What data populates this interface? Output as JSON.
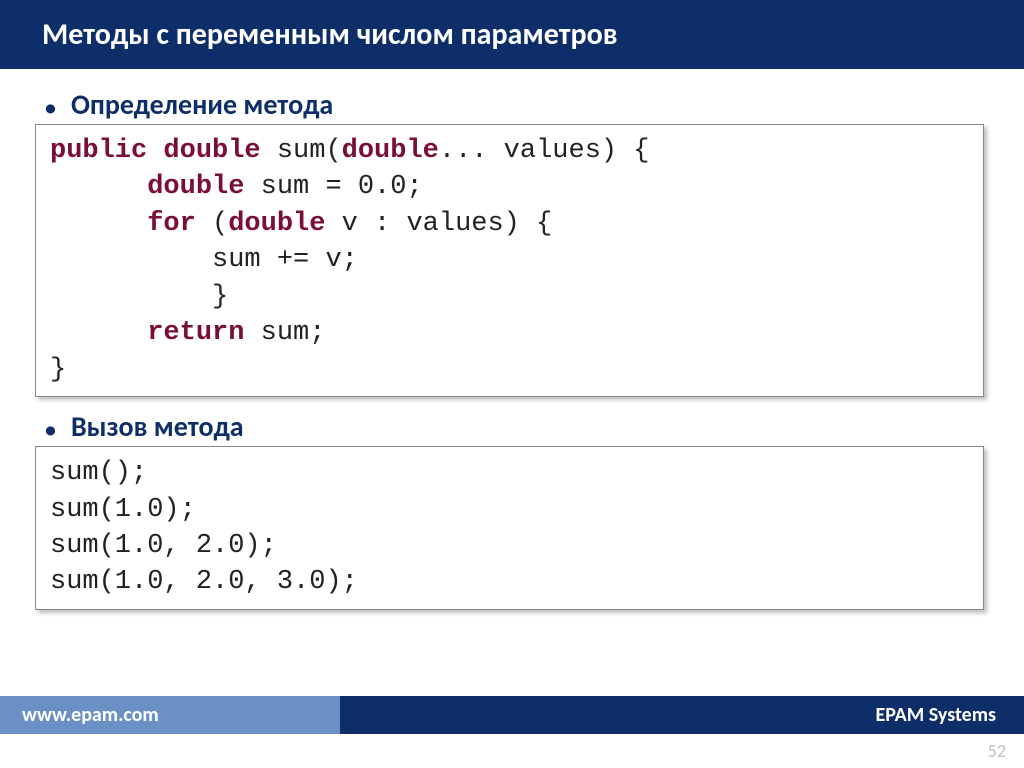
{
  "title": "Методы с переменным числом параметров",
  "bullets": {
    "definition": "Определение метода",
    "call": "Вызов метода"
  },
  "code1": {
    "tokens": [
      {
        "t": "public",
        "c": "kw"
      },
      {
        "t": " "
      },
      {
        "t": "double",
        "c": "kw"
      },
      {
        "t": " sum("
      },
      {
        "t": "double",
        "c": "kw"
      },
      {
        "t": "... values) {\n"
      },
      {
        "t": "      "
      },
      {
        "t": "double",
        "c": "kw"
      },
      {
        "t": " sum = 0.0;\n"
      },
      {
        "t": "      "
      },
      {
        "t": "for",
        "c": "kw"
      },
      {
        "t": " ("
      },
      {
        "t": "double",
        "c": "kw"
      },
      {
        "t": " v : values) {\n"
      },
      {
        "t": "          sum += v;\n"
      },
      {
        "t": "          }\n"
      },
      {
        "t": "      "
      },
      {
        "t": "return",
        "c": "kw"
      },
      {
        "t": " sum;\n"
      },
      {
        "t": "}"
      }
    ]
  },
  "code2": "sum();\nsum(1.0);\nsum(1.0, 2.0);\nsum(1.0, 2.0, 3.0);",
  "footer": {
    "left": "www.epam.com",
    "right": "EPAM Systems"
  },
  "page": "52"
}
